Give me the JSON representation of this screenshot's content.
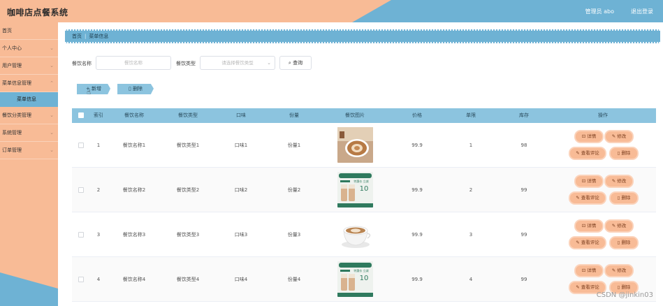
{
  "header": {
    "title": "咖啡店点餐系统",
    "user": "管理员 abo",
    "logout": "退出登录",
    "accent_blue": "#6eb2d4",
    "accent_peach": "#f8bb96"
  },
  "sidebar": {
    "items": [
      {
        "label": "首页"
      },
      {
        "label": "个人中心",
        "chevron": "⌄"
      },
      {
        "label": "用户管理",
        "chevron": "⌄"
      },
      {
        "label": "菜单信息管理",
        "chevron": "⌃"
      },
      {
        "label": "菜单信息"
      },
      {
        "label": "餐饮分类管理",
        "chevron": "⌄"
      },
      {
        "label": "系统管理",
        "chevron": "⌄"
      },
      {
        "label": "订单管理",
        "chevron": "⌄"
      }
    ]
  },
  "breadcrumb": {
    "home": "首页",
    "separator": "|",
    "current": "菜单信息"
  },
  "search": {
    "name_label": "餐饮名称",
    "name_placeholder": "餐饮名称",
    "type_label": "餐饮类型",
    "type_placeholder": "请选择餐饮类型",
    "query_label": "查询",
    "query_icon": "search-icon"
  },
  "actions": {
    "add_label": "+ 新增",
    "delete_label": "删除"
  },
  "table": {
    "headers": [
      "索引",
      "餐饮名称",
      "餐饮类型",
      "口味",
      "份量",
      "餐饮图片",
      "价格",
      "单限",
      "库存",
      "操作"
    ],
    "rows": [
      {
        "index": "1",
        "name": "餐饮名称1",
        "type": "餐饮类型1",
        "taste": "口味1",
        "portion": "份量1",
        "image": "latte-art",
        "price": "99.9",
        "limit": "1",
        "stock": "98"
      },
      {
        "index": "2",
        "name": "餐饮名称2",
        "type": "餐饮类型2",
        "taste": "口味2",
        "portion": "份量2",
        "image": "promo-card",
        "price": "99.9",
        "limit": "2",
        "stock": "99"
      },
      {
        "index": "3",
        "name": "餐饮名称3",
        "type": "餐饮类型3",
        "taste": "口味3",
        "portion": "份量3",
        "image": "cappuccino",
        "price": "99.9",
        "limit": "3",
        "stock": "99"
      },
      {
        "index": "4",
        "name": "餐饮名称4",
        "type": "餐饮类型4",
        "taste": "口味4",
        "portion": "份量4",
        "image": "promo-card",
        "price": "99.9",
        "limit": "4",
        "stock": "99"
      }
    ],
    "row_actions": {
      "detail": "详情",
      "edit": "修改",
      "comments": "查看评论",
      "delete": "删除"
    }
  },
  "promo_card": {
    "line1": "特惠价 立减",
    "price_big": "10"
  },
  "watermark": "CSDN @jinkin03"
}
